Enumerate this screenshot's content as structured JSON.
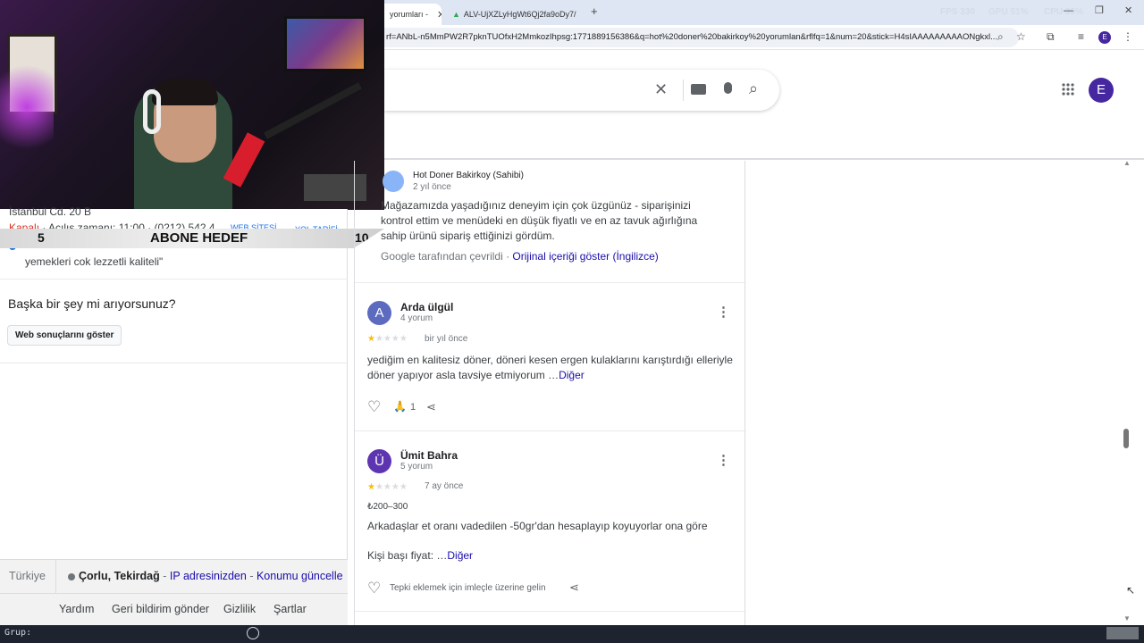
{
  "browser": {
    "tabs": [
      {
        "label": "yorumları -"
      },
      {
        "label": "ALV-UjXZLyHgWt6Qj2fa9oDy7/"
      }
    ],
    "new_tab_symbol": "+",
    "url": "rf=ANbL-n5MmPW2R7pknTUOfxH2MmkozIhpsg:1771889156386&q=hot%20doner%20bakirkoy%20yorumlan&rflfq=1&num=20&stick=H4sIAAAAAAAAAONgkxl...",
    "profile_initial": "E",
    "stats": [
      {
        "label": "FPS",
        "value": "330"
      },
      {
        "label": "GPU",
        "value": "51%"
      },
      {
        "label": "CPU",
        "value": "39%"
      }
    ]
  },
  "google": {
    "profile_initial": "E"
  },
  "overlay": {
    "left_number": "5",
    "goal_label": "ABONE HEDEF",
    "right_number": "10"
  },
  "left_panel": {
    "address": "İstanbul Cd. 20 B",
    "hours_prefix": "Kapalı",
    "hours_rest": " · Açılış zamanı: 11:00 · (0212) 542 4",
    "website_label": "WEB SİTESİ",
    "directions_label": "YOL TARİFİ",
    "quote": "yemekleri cok lezzetli kaliteli\"",
    "question": "Başka bir şey mi arıyorsunuz?",
    "web_results_button": "Web sonuçlarını göster",
    "footer": {
      "country": "Türkiye",
      "location": "Çorlu, Tekirdağ",
      "ip_link": "IP adresinizden",
      "separator": "-",
      "update_link": "Konumu güncelle",
      "links": [
        "Yardım",
        "Geri bildirim gönder",
        "Gizlilik",
        "Şartlar"
      ]
    }
  },
  "reviews": [
    {
      "owner_name": "Hot Doner Bakirkoy (Sahibi)",
      "time": "2 yıl önce",
      "text": "Mağazamızda yaşadığınız deneyim için çok üzgünüz - siparişinizi kontrol ettim ve menüdeki en düşük fiyatlı ve en az tavuk ağırlığına sahip ürünü sipariş ettiğinizi gördüm.",
      "translated_by": "Google tarafından çevrildi ·",
      "show_original": "Orijinal içeriği göster (İngilizce)"
    },
    {
      "initial": "A",
      "avatar_color": "#5c6bc0",
      "name": "Arda ülgül",
      "count": "4 yorum",
      "rating": 1,
      "time": "bir yıl önce",
      "text": "yediğim en kalitesiz döner, döneri kesen ergen kulaklarını karıştırdığı elleriyle döner yapıyor asla tavsiye etmiyorum …",
      "more": "Diğer",
      "reaction_count": "1"
    },
    {
      "initial": "Ü",
      "avatar_color": "#5e35b1",
      "name": "Ümit Bahra",
      "count": "5 yorum",
      "rating": 1,
      "time": "7 ay önce",
      "price": "₺200–300",
      "text": "Arkadaşlar et oranı vadedilen -50gr'dan hesaplayıp koyuyorlar ona göre",
      "text2": "Kişi başı fiyat: …",
      "more": "Diğer",
      "reaction_hint": "Tepki eklemek için imleçle üzerine gelin"
    }
  ],
  "taskbar": {
    "label": "Grup:"
  },
  "colors": {
    "link": "#1a0dab",
    "star": "#fbbc04",
    "profile": "#4527a0"
  }
}
